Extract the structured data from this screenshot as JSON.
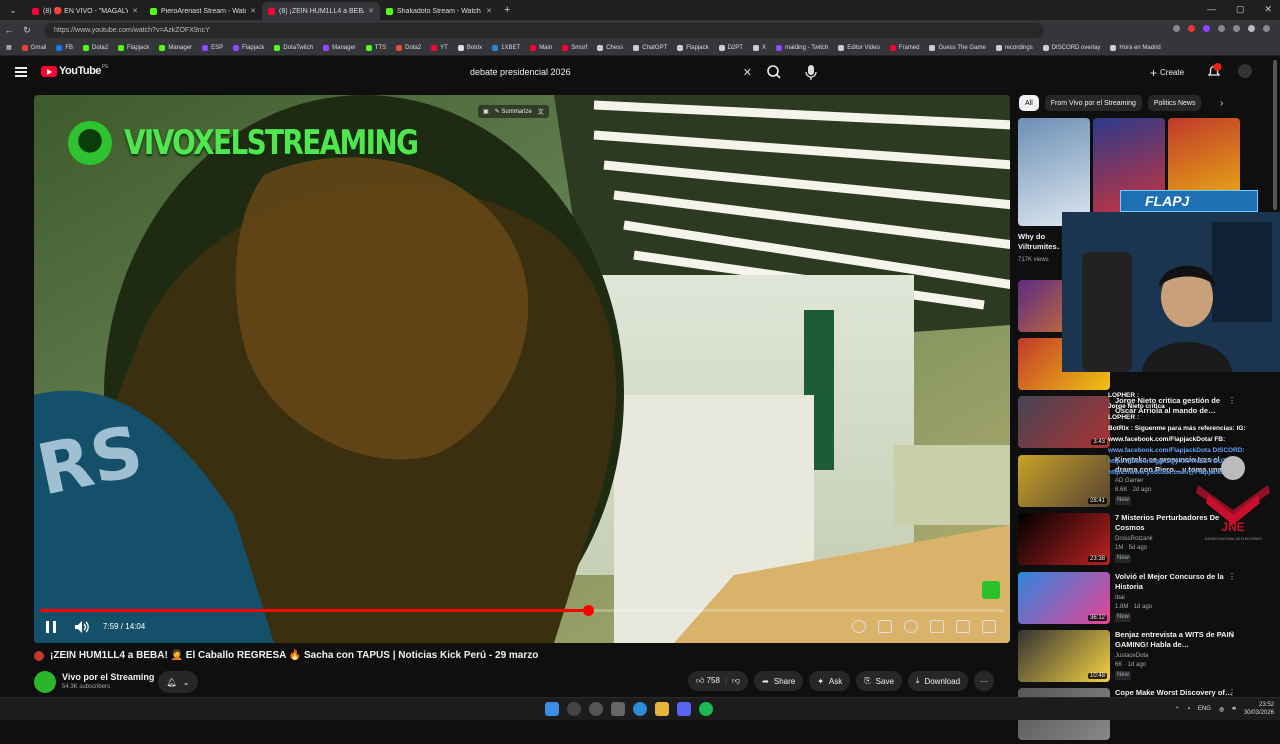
{
  "browser": {
    "tabs": [
      {
        "label": "(8) 🔴 EN VIVO - \"MAGALY TV LA",
        "color": "#ff0033"
      },
      {
        "label": "PieroArenast Stream - Watch Live",
        "color": "#53fc18"
      },
      {
        "label": "(8) ¡ZEIN HUM1LL4 a BEBA!",
        "color": "#ff0033"
      },
      {
        "label": "Shakadoto Stream - Watch Live o",
        "color": "#53fc18"
      }
    ],
    "url": "https://www.youtube.com/watch?v=AzkZOFX9ncY",
    "bookmarks": [
      {
        "label": "Gmail",
        "color": "#ea4335"
      },
      {
        "label": "FB",
        "color": "#1877f2"
      },
      {
        "label": "Dota2",
        "color": "#53fc18"
      },
      {
        "label": "Flapjack",
        "color": "#53fc18"
      },
      {
        "label": "Manager",
        "color": "#53fc18"
      },
      {
        "label": "ESP",
        "color": "#9146ff"
      },
      {
        "label": "Flapjack",
        "color": "#9146ff"
      },
      {
        "label": "DotaTwitch",
        "color": "#53fc18"
      },
      {
        "label": "Manager",
        "color": "#9146ff"
      },
      {
        "label": "TTS",
        "color": "#53fc18"
      },
      {
        "label": "Dota2",
        "color": "#e74c3c"
      },
      {
        "label": "YT",
        "color": "#ff0033"
      },
      {
        "label": "Botrix",
        "color": "#ddd"
      },
      {
        "label": "1XBET",
        "color": "#1e88e5"
      },
      {
        "label": "Main",
        "color": "#ff0033"
      },
      {
        "label": "Smurf",
        "color": "#ff0033"
      },
      {
        "label": "Chess",
        "color": "#ccc"
      },
      {
        "label": "ChatGPT",
        "color": "#ccc"
      },
      {
        "label": "Flapjack",
        "color": "#ccc"
      },
      {
        "label": "D2PT",
        "color": "#ccc"
      },
      {
        "label": "X",
        "color": "#ccc"
      },
      {
        "label": "malding - Twitch",
        "color": "#9146ff"
      },
      {
        "label": "Editor Video",
        "color": "#ccc"
      },
      {
        "label": "Framed",
        "color": "#ff0033"
      },
      {
        "label": "Guess The Game",
        "color": "#ccc"
      },
      {
        "label": "recordings",
        "color": "#ccc"
      },
      {
        "label": "DISCORD overlay",
        "color": "#ccc"
      },
      {
        "label": "Hora en Madrid",
        "color": "#ccc"
      }
    ]
  },
  "youtube": {
    "logo_text": "YouTube",
    "logo_region": "PE",
    "search_query": "debate presidencial 2026",
    "create_label": "Create",
    "notif_count": "9+"
  },
  "player": {
    "watermark": "VIVOXELSTREAMING",
    "summarize_label": "Summarize",
    "time": "7:59 / 14:04",
    "progress_fraction": 0.568,
    "buffered_fraction": 0.57
  },
  "video": {
    "title": "¡ZEIN HUM1LL4 a BEBA! 🤦 El Caballo REGRESA 🔥 Sacha con TAPUS | Noticias Kick Perú - 29 marzo",
    "channel": "Vivo por el Streaming",
    "subscribers": "54.3K subscribers",
    "likes": "758",
    "share": "Share",
    "ask": "Ask",
    "save": "Save",
    "download": "Download"
  },
  "chips": [
    "All",
    "From Vivo por el Streaming",
    "Politics News"
  ],
  "recommendations": [
    {
      "title": "Why do Viltrumites…",
      "channel": "",
      "meta": "717K views",
      "dur": "",
      "thumb": [
        "#6b8fb5",
        "#dfe8f0"
      ]
    },
    {
      "title": "",
      "channel": "",
      "meta": "",
      "dur": "",
      "thumb": [
        "#2b3a8a",
        "#d33"
      ]
    },
    {
      "title": "",
      "channel": "",
      "meta": "",
      "dur": "",
      "thumb": [
        "#c0392b",
        "#f1c40f"
      ]
    },
    {
      "title": "Jorge Nieto critica gestión de Óscar Arriola al mando de…",
      "channel": "",
      "meta": "",
      "dur": "3:43",
      "thumb": [
        "#445",
        "#a33"
      ]
    },
    {
      "title": "Kingteka se pronuncia tras el drama con Piero... y toma una…",
      "channel": "AD Gamer",
      "meta": "8.6K · 2d ago",
      "dur": "28:41",
      "thumb": [
        "#c9a227",
        "#543"
      ]
    },
    {
      "title": "7 Misterios Perturbadores De Cosmos",
      "channel": "DrossRotzank",
      "meta": "1M · 5d ago",
      "dur": "23:38",
      "thumb": [
        "#000",
        "#b22"
      ]
    },
    {
      "title": "Volvió el Mejor Concurso de la Historia",
      "channel": "Ibai",
      "meta": "1.8M · 1d ago",
      "dur": "36:12",
      "thumb": [
        "#2e86de",
        "#e84393"
      ]
    },
    {
      "title": "Benjaz entrevista a WITS de PAIN GAMING! Habla de…",
      "channel": "JustaceDota",
      "meta": "6K · 1d ago",
      "dur": "10:48",
      "thumb": [
        "#333",
        "#f5d142"
      ]
    },
    {
      "title": "Cope Make Worst Discovery of…",
      "channel": "",
      "meta": "",
      "dur": "",
      "thumb": [
        "#555",
        "#888"
      ]
    }
  ],
  "rec_badges": {
    "new": "New"
  },
  "stream_overlay": {
    "banner": "FLAPJ",
    "chat_lines": [
      "LOPHER :",
      "Jorge Nieto critica",
      "LOPHER : ",
      "BotRix : Síguenme para más referencias: IG: www.facebook.com/FlapjackDota/ FB:",
      "www.facebook.com/FlapjackDota DISCORD:",
      "https://discord.gg/GQy7XvYNSa YOUTUBE:",
      "https://www.youtube.com/@FlapjackDota"
    ],
    "jne_text": "JNE",
    "jne_sub": "JURADO NACIONAL DE ELECCIONES"
  },
  "taskbar": {
    "lang": "ENG",
    "time": "23:52",
    "date": "30/03/2026"
  }
}
